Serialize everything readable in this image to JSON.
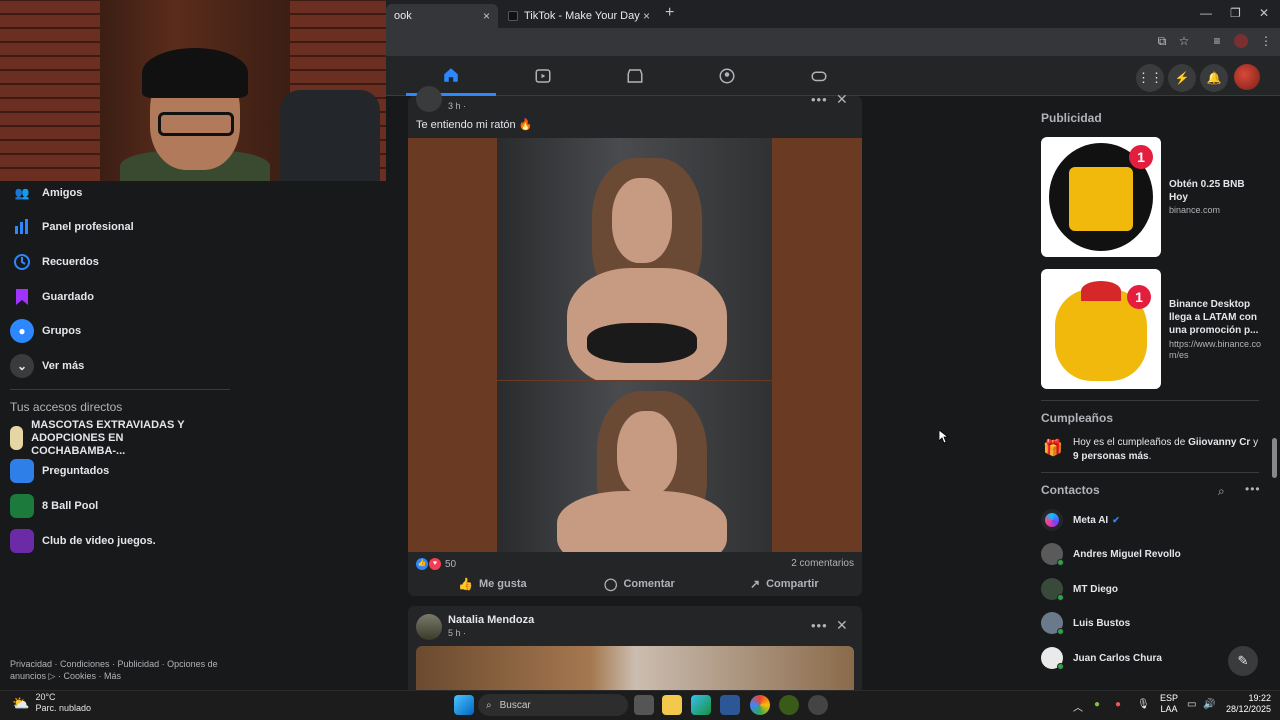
{
  "browser": {
    "tabs": [
      {
        "label": "ook",
        "active": true
      },
      {
        "label": "TikTok - Make Your Day",
        "active": false
      }
    ],
    "new_tab": "+",
    "close_glyph": "×"
  },
  "webcam": {
    "description_icon": "webcam-overlay"
  },
  "sidebar": {
    "items": [
      {
        "label": "Amigos",
        "icon": "friends-icon",
        "color": "#2d88ff"
      },
      {
        "label": "Panel profesional",
        "icon": "dashboard-icon",
        "color": "#2d88ff"
      },
      {
        "label": "Recuerdos",
        "icon": "memories-clock-icon",
        "color": "#2d88ff"
      },
      {
        "label": "Guardado",
        "icon": "saved-bookmark-icon",
        "color": "#a033ff"
      },
      {
        "label": "Grupos",
        "icon": "groups-icon",
        "color": "#2d88ff"
      },
      {
        "label": "Ver más",
        "icon": "chevron-down-icon",
        "color": "#3a3b3c"
      }
    ],
    "shortcuts_title": "Tus accesos directos",
    "shortcuts": [
      {
        "label": "MASCOTAS EXTRAVIADAS Y ADOPCIONES EN COCHABAMBA-...",
        "color": "#e5d6a3"
      },
      {
        "label": "Preguntados",
        "color": "#2f7fe8"
      },
      {
        "label": "8 Ball Pool",
        "color": "#1b7a3c"
      },
      {
        "label": "Club de video juegos.",
        "color": "#6b2aa6"
      }
    ],
    "footer": "Privacidad · Condiciones · Publicidad · Opciones de anuncios ▷ · Cookies · Más"
  },
  "feed": {
    "post1": {
      "time": "3 h ·",
      "text": "Te entiendo mi ratón 🔥",
      "reaction_count": "50",
      "comments": "2 comentarios",
      "like": "Me gusta",
      "comment": "Comentar",
      "share": "Compartir"
    },
    "post2": {
      "author": "Natalia Mendoza",
      "time": "5 h ·"
    }
  },
  "right": {
    "ads_title": "Publicidad",
    "ads": [
      {
        "title": "Obtén 0.25 BNB Hoy",
        "domain": "binance.com",
        "badge": "1"
      },
      {
        "title": "Binance Desktop llega a LATAM con una promoción p...",
        "domain": "https://www.binance.com/es",
        "badge": "1"
      }
    ],
    "birthdays_title": "Cumpleaños",
    "birthday_prefix": "Hoy es el cumpleaños de ",
    "birthday_name": "Giiovanny Cr",
    "birthday_mid": " y ",
    "birthday_others": "9 personas más",
    "birthday_end": ".",
    "contacts_title": "Contactos",
    "contacts": [
      {
        "name": "Meta AI",
        "verified": true
      },
      {
        "name": "Andres Miguel Revollo"
      },
      {
        "name": "MT Diego"
      },
      {
        "name": "Luis Bustos"
      },
      {
        "name": "Juan Carlos Chura"
      }
    ]
  },
  "taskbar": {
    "weather_temp": "20°C",
    "weather_desc": "Parc. nublado",
    "search": "Buscar",
    "lang_top": "ESP",
    "lang_bottom": "LAA",
    "time": "19:22",
    "date": "28/12/2025"
  },
  "colors": {
    "accent": "#2d88ff",
    "bg": "#18191a",
    "card": "#242526"
  }
}
